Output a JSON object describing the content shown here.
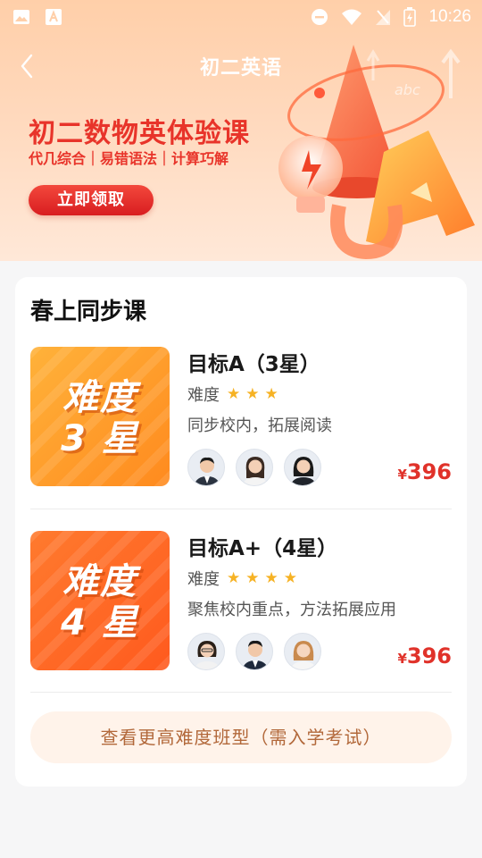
{
  "status_bar": {
    "time": "10:26",
    "left_icons": [
      "image-icon",
      "app-icon"
    ],
    "right_icons": [
      "dnd-icon",
      "wifi-icon",
      "signal-icon",
      "battery-icon"
    ]
  },
  "nav": {
    "title": "初二英语",
    "back_icon": "chevron-left-icon"
  },
  "hero": {
    "heading": "初二数物英体验课",
    "subtitle": "代几综合｜易错语法｜计算巧解",
    "cta_label": "立即领取"
  },
  "section": {
    "title": "春上同步课"
  },
  "courses": [
    {
      "thumb_line1": "难度",
      "thumb_line2": "3 星",
      "title": "目标A（3星）",
      "difficulty_label": "难度",
      "stars": 3,
      "description": "同步校内，拓展阅读",
      "currency": "¥",
      "price": "396"
    },
    {
      "thumb_line1": "难度",
      "thumb_line2": "4 星",
      "title": "目标A+（4星）",
      "difficulty_label": "难度",
      "stars": 4,
      "description": "聚焦校内重点，方法拓展应用",
      "currency": "¥",
      "price": "396"
    }
  ],
  "more_button": {
    "label": "查看更高难度班型（需入学考试）"
  },
  "colors": {
    "accent": "#e8342a",
    "price": "#e0322a",
    "star": "#f6b224",
    "more_text": "#b2683a"
  }
}
